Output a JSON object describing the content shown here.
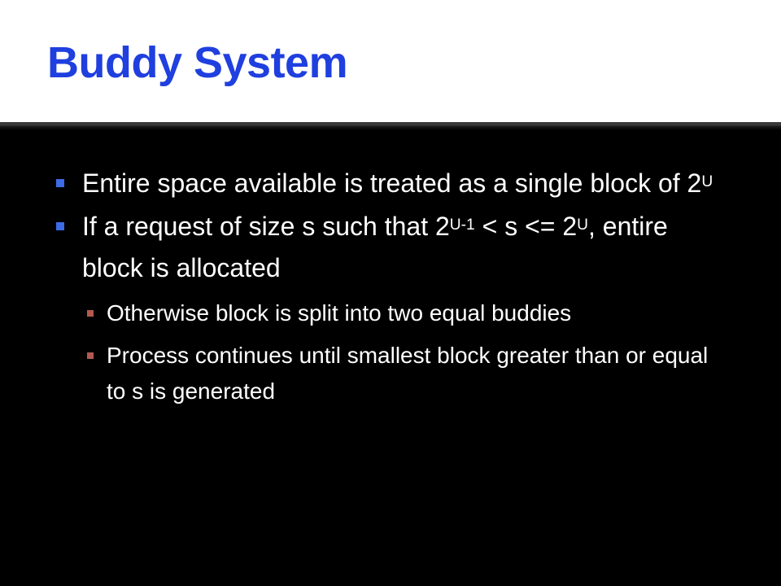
{
  "title": "Buddy System",
  "bullets": [
    {
      "text_before": "Entire space available is treated as a single block of 2",
      "sup": "U",
      "text_after": ""
    },
    {
      "text_before": "If a request of size s such that 2",
      "sup1": "U-1",
      "text_middle": " < s <= 2",
      "sup2": "U",
      "text_after": ", entire block is allocated"
    }
  ],
  "sub_bullets": [
    "Otherwise block is split into two equal buddies",
    "Process continues until smallest block greater than or equal to s is generated"
  ],
  "colors": {
    "title": "#1f3fdf",
    "bullet_marker": "#3d6be6",
    "sub_bullet_marker": "#b25a4f",
    "background": "#000000",
    "title_band": "#ffffff",
    "text": "#ffffff"
  }
}
